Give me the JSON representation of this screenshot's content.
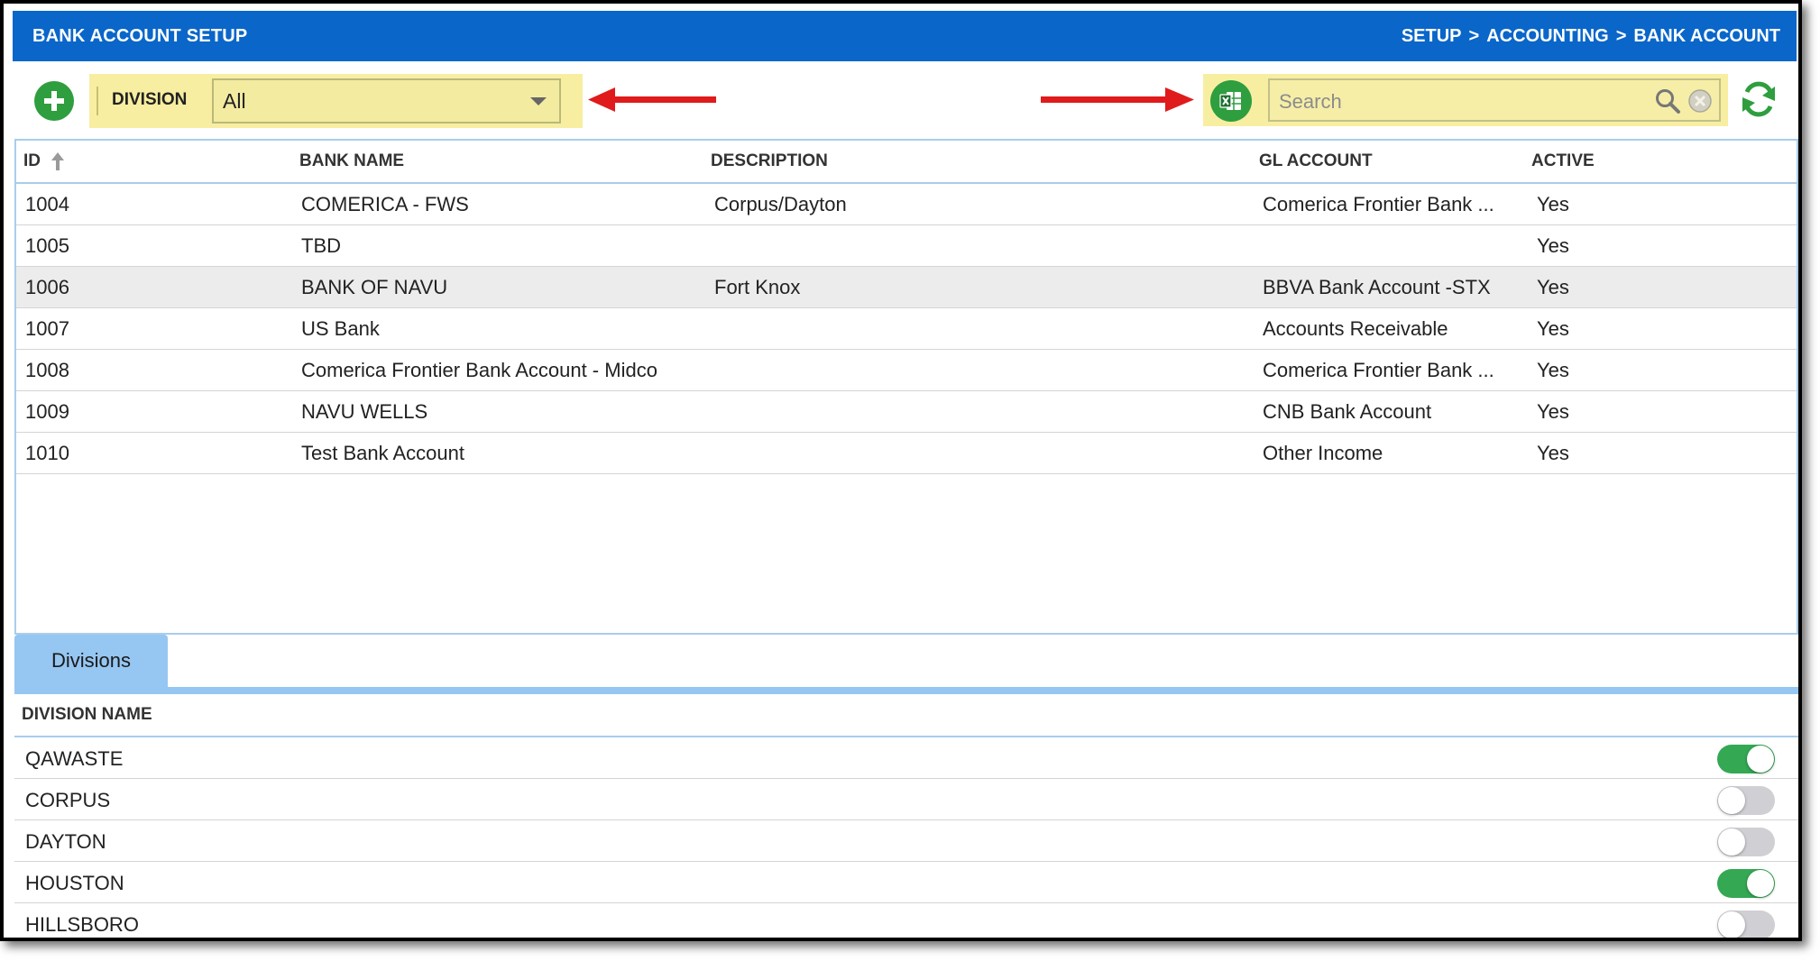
{
  "header": {
    "title": "BANK ACCOUNT SETUP",
    "breadcrumb": [
      "SETUP",
      ">",
      "ACCOUNTING",
      ">",
      "BANK ACCOUNT"
    ]
  },
  "toolbar": {
    "division_label": "DIVISION",
    "division_value": "All",
    "search_placeholder": "Search"
  },
  "colors": {
    "header": "#0a66c9",
    "highlight": "#f8eea1",
    "green": "#2e9e3f",
    "annotation_arrow": "#e01b1b",
    "tab": "#96c6f2"
  },
  "grid": {
    "columns": [
      "ID",
      "BANK NAME",
      "DESCRIPTION",
      "GL ACCOUNT",
      "ACTIVE"
    ],
    "rows": [
      {
        "id": "1004",
        "bank_name": "COMERICA - FWS",
        "description": "Corpus/Dayton",
        "gl_account": "Comerica Frontier Bank ...",
        "active": "Yes"
      },
      {
        "id": "1005",
        "bank_name": "TBD",
        "description": "",
        "gl_account": "",
        "active": "Yes"
      },
      {
        "id": "1006",
        "bank_name": "BANK OF NAVU",
        "description": "Fort Knox",
        "gl_account": "BBVA Bank Account -STX",
        "active": "Yes"
      },
      {
        "id": "1007",
        "bank_name": "US Bank",
        "description": "",
        "gl_account": "Accounts Receivable",
        "active": "Yes"
      },
      {
        "id": "1008",
        "bank_name": "Comerica Frontier Bank Account - Midco",
        "description": "",
        "gl_account": "Comerica Frontier Bank ...",
        "active": "Yes"
      },
      {
        "id": "1009",
        "bank_name": "NAVU WELLS",
        "description": "",
        "gl_account": "CNB Bank Account",
        "active": "Yes"
      },
      {
        "id": "1010",
        "bank_name": "Test Bank Account",
        "description": "",
        "gl_account": "Other Income",
        "active": "Yes"
      }
    ]
  },
  "tabs": [
    {
      "label": "Divisions"
    }
  ],
  "divisions": {
    "column": "DIVISION NAME",
    "rows": [
      {
        "name": "QAWASTE",
        "enabled": true
      },
      {
        "name": "CORPUS",
        "enabled": false
      },
      {
        "name": "DAYTON",
        "enabled": false
      },
      {
        "name": "HOUSTON",
        "enabled": true
      },
      {
        "name": "HILLSBORO",
        "enabled": false
      }
    ]
  }
}
